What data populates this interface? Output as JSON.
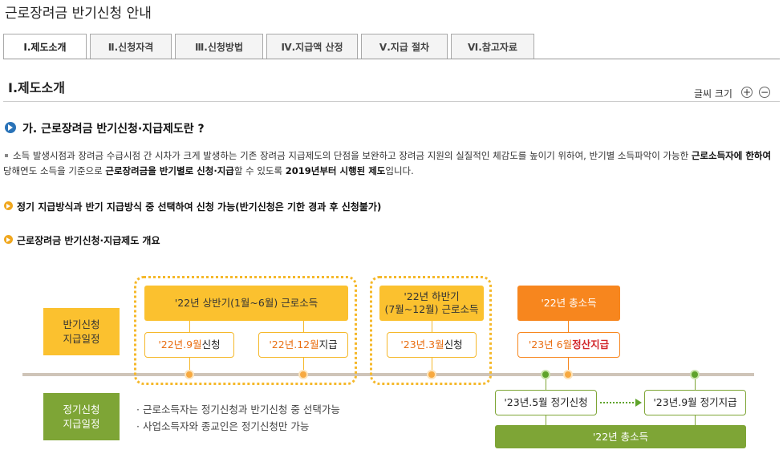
{
  "page_title": "근로장려금 반기신청 안내",
  "tabs": [
    {
      "label": "Ⅰ.제도소개",
      "active": true
    },
    {
      "label": "Ⅱ.신청자격",
      "active": false
    },
    {
      "label": "Ⅲ.신청방법",
      "active": false
    },
    {
      "label": "Ⅳ.지급액 산정",
      "active": false
    },
    {
      "label": "Ⅴ.지급 절차",
      "active": false
    },
    {
      "label": "Ⅵ.참고자료",
      "active": false
    }
  ],
  "section_title": "Ⅰ.제도소개",
  "font_size": {
    "label": "글씨 크기",
    "plus": "+",
    "minus": "−"
  },
  "question": "가. 근로장려금 반기신청·지급제도란 ?",
  "paragraph": {
    "p1": "소득 발생시점과 장려금 수급시점 간 시차가 크게 발생하는 기존 장려금 지급제도의 단점을 보완하고 장려금 지원의 실질적인 체감도를 높이기 위하여, 반기별 소득파악이 가능한 ",
    "b1": "근로소득자에 한하여",
    "p2": " 당해연도 소득을 기준으로 ",
    "b2": "근로장려금을 반기별로 신청·지급",
    "p3": "할 수 있도록 ",
    "b3": "2019년부터 시행된 제도",
    "p4": "입니다."
  },
  "bullets": [
    "정기 지급방식과 반기 지급방식 중 선택하여 신청 가능(반기신청은 기한 경과 후 신청불가)",
    "근로장려금 반기신청·지급제도 개요"
  ],
  "diagram": {
    "half_label": [
      "반기신청",
      "지급일정"
    ],
    "regular_label": [
      "정기신청",
      "지급일정"
    ],
    "h1_income": "'22년 상반기(1월~6월) 근로소득",
    "h1_apply": {
      "date": "'22년.9월",
      "text": " 신청"
    },
    "h1_pay": {
      "date": "'22년.12월",
      "text": " 지급"
    },
    "h2_income": [
      "'22년 하반기",
      "(7월~12월) 근로소득"
    ],
    "h2_apply": {
      "date": "'23년.3월",
      "text": " 신청"
    },
    "total_income": "'22년 총소득",
    "settle": {
      "date": "'23년 6월",
      "text": " 정산지급"
    },
    "reg_apply": "'23년.5월 정기신청",
    "reg_pay": "'23년.9월 정기지급",
    "reg_income": "'22년 총소득",
    "notes": [
      "· 근로소득자는 정기신청과 반기신청 중 선택가능",
      "· 사업소득자와 종교인은 정기신청만 가능"
    ]
  },
  "colors": {
    "yellow": "#fbc12f",
    "orange": "#f7861e",
    "green": "#7ea536",
    "accent_blue": "#2a73b8"
  }
}
